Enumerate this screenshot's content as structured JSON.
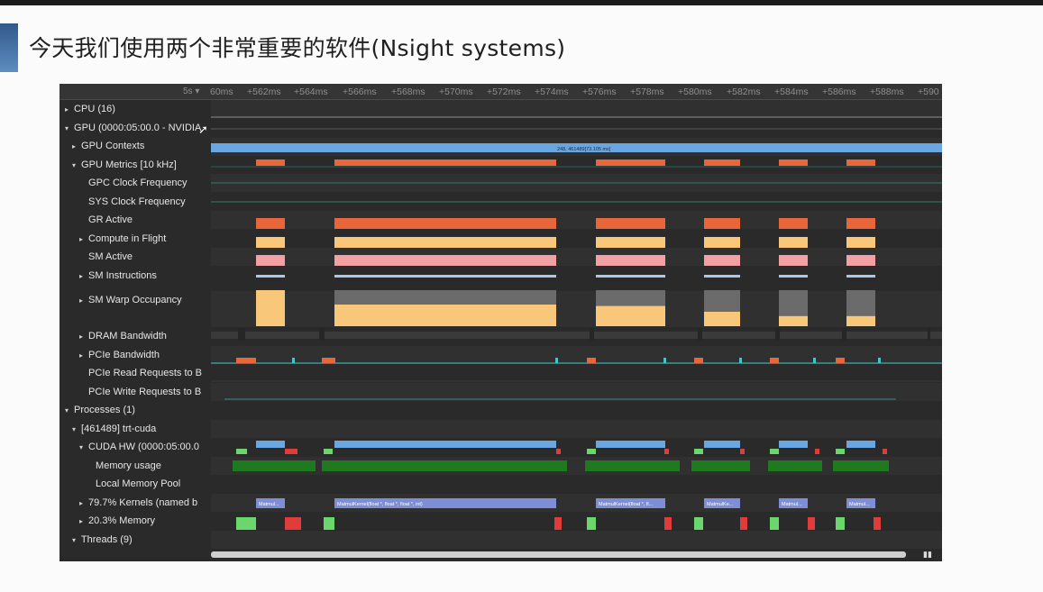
{
  "slide": {
    "title": "今天我们使用两个非常重要的软件(Nsight systems)"
  },
  "ruler": {
    "zoom_label": "5s",
    "ticks": [
      "60ms",
      "+562ms",
      "+564ms",
      "+566ms",
      "+568ms",
      "+570ms",
      "+572ms",
      "+574ms",
      "+576ms",
      "+578ms",
      "+580ms",
      "+582ms",
      "+584ms",
      "+586ms",
      "+588ms",
      "+590"
    ]
  },
  "tree": [
    {
      "label": "CPU (16)",
      "arrow": "▸",
      "indent": 0
    },
    {
      "label": "GPU (0000:05:00.0 - NVIDIA",
      "arrow": "▾",
      "indent": 0
    },
    {
      "label": "GPU Contexts",
      "arrow": "▸",
      "indent": 1
    },
    {
      "label": "GPU Metrics [10 kHz]",
      "arrow": "▾",
      "indent": 1
    },
    {
      "label": "GPC Clock Frequency",
      "arrow": "",
      "indent": 2
    },
    {
      "label": "SYS Clock Frequency",
      "arrow": "",
      "indent": 2
    },
    {
      "label": "GR Active",
      "arrow": "",
      "indent": 2
    },
    {
      "label": "Compute in Flight",
      "arrow": "▸",
      "indent": 2
    },
    {
      "label": "SM Active",
      "arrow": "",
      "indent": 2
    },
    {
      "label": "SM Instructions",
      "arrow": "▸",
      "indent": 2
    },
    {
      "label": "SM Warp Occupancy",
      "arrow": "▸",
      "indent": 2
    },
    {
      "label": "DRAM Bandwidth",
      "arrow": "▸",
      "indent": 2
    },
    {
      "label": "PCIe Bandwidth",
      "arrow": "▸",
      "indent": 2
    },
    {
      "label": "PCIe Read Requests to B",
      "arrow": "",
      "indent": 2
    },
    {
      "label": "PCIe Write Requests to B",
      "arrow": "",
      "indent": 2
    },
    {
      "label": "Processes (1)",
      "arrow": "▾",
      "indent": 0
    },
    {
      "label": "[461489] trt-cuda",
      "arrow": "▾",
      "indent": 1
    },
    {
      "label": "CUDA HW (0000:05:00.0",
      "arrow": "▾",
      "indent": 2
    },
    {
      "label": "Memory usage",
      "arrow": "",
      "indent": 3
    },
    {
      "label": "Local Memory Pool",
      "arrow": "",
      "indent": 3
    },
    {
      "label": "79.7% Kernels (named b",
      "arrow": "▸",
      "indent": 2
    },
    {
      "label": "20.3% Memory",
      "arrow": "▸",
      "indent": 2
    },
    {
      "label": "Threads (9)",
      "arrow": "▾",
      "indent": 1
    }
  ],
  "context_bar_label": "248, 461489[73.105 ms]",
  "kernel_labels": [
    "Matmul...",
    "MatmulKernel(float *, float *, float *, int)",
    "MatmulKernel(float *, fl...",
    "MatmulKe...",
    "Matmul...",
    "Matmul..."
  ],
  "colors": {
    "gr_active": "#e8663a",
    "compute_in_flight": "#f8c77a",
    "sm_active": "#f2a0a4",
    "sm_instructions": "#a9c8ec",
    "warp_gray": "#6b6b6b",
    "context_blue": "#6aa7e0",
    "kernel_blue": "#7d8ed6",
    "memory_green": "#1f7a1f",
    "mem_bright_green": "#6bd66b",
    "mem_red": "#e03c3c",
    "pcie_cyan": "#40c8c8"
  },
  "icons": {
    "cursor": "mouse-pointer-icon"
  }
}
